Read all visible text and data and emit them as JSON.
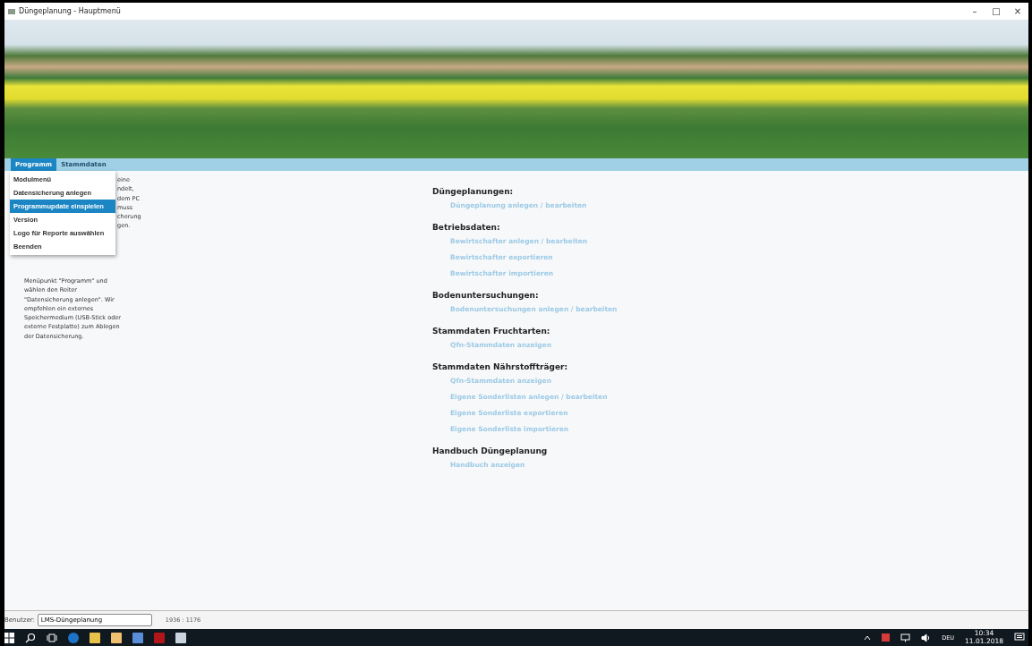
{
  "window": {
    "title": "Düngeplanung - Hauptmenü",
    "controls": [
      "–",
      "□",
      "×"
    ]
  },
  "menubar": [
    {
      "label": "Programm",
      "selected": true
    },
    {
      "label": "Stammdaten",
      "selected": false
    }
  ],
  "dropdown": [
    {
      "label": "Modulmenü",
      "selected": false
    },
    {
      "label": "Datensicherung anlegen",
      "selected": false
    },
    {
      "label": "Programmupdate einspielen",
      "selected": true
    },
    {
      "label": "Version",
      "selected": false
    },
    {
      "label": "Logo für Reporte auswählen",
      "selected": false
    },
    {
      "label": "Beenden",
      "selected": false
    }
  ],
  "info_text": {
    "covered_fragments": [
      "eine",
      "ndelt,",
      "dem PC",
      "muss",
      "cherung",
      "gen."
    ],
    "lines": [
      "Menüpunkt \"Programm\" und",
      "wählen den Reiter",
      "\"Datensicherung anlegen\". Wir",
      "empfehlen ein externes",
      "Speichermedium (USB-Stick oder",
      "externe Festplatte) zum Ablegen",
      "der Datensicherung."
    ]
  },
  "sections": [
    {
      "heading": "Düngeplanungen:",
      "links": [
        "Düngeplanung anlegen / bearbeiten"
      ]
    },
    {
      "heading": "Betriebsdaten:",
      "links": [
        "Bewirtschafter anlegen / bearbeiten",
        "Bewirtschafter exportieren",
        "Bewirtschafter importieren"
      ]
    },
    {
      "heading": "Bodenuntersuchungen:",
      "links": [
        "Bodenuntersuchungen anlegen / bearbeiten"
      ]
    },
    {
      "heading": "Stammdaten Fruchtarten:",
      "links": [
        "Qfn-Stammdaten anzeigen"
      ]
    },
    {
      "heading": "Stammdaten Nährstoffträger:",
      "links": [
        "Qfn-Stammdaten anzeigen",
        "Eigene Sonderlisten anlegen / bearbeiten",
        "Eigene Sonderliste exportieren",
        "Eigene Sonderliste importieren"
      ]
    },
    {
      "heading": "Handbuch Düngeplanung",
      "links": [
        "Handbuch anzeigen"
      ]
    }
  ],
  "status_bar": {
    "user_label": "Benutzer:",
    "user_value": "LMS-Düngeplanung",
    "resolution": "1936 : 1176"
  },
  "taskbar": {
    "language": "DEU",
    "time": "10:34",
    "date": "11.01.2018"
  }
}
